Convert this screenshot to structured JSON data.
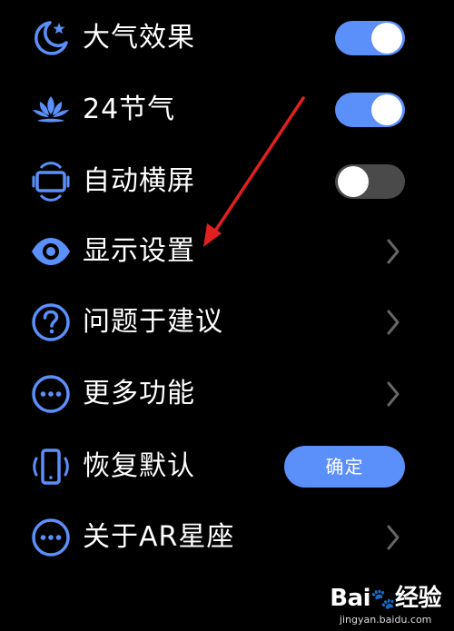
{
  "menu": {
    "items": [
      {
        "label": "大气效果",
        "icon": "moon-star-icon",
        "control": "toggle",
        "state": "on"
      },
      {
        "label": "24节气",
        "icon": "lotus-icon",
        "control": "toggle",
        "state": "on"
      },
      {
        "label": "自动横屏",
        "icon": "auto-rotate-icon",
        "control": "toggle",
        "state": "off"
      },
      {
        "label": "显示设置",
        "icon": "eye-icon",
        "control": "chevron"
      },
      {
        "label": "问题于建议",
        "icon": "question-icon",
        "control": "chevron"
      },
      {
        "label": "更多功能",
        "icon": "more-icon",
        "control": "chevron"
      },
      {
        "label": "恢复默认",
        "icon": "phone-reset-icon",
        "control": "button",
        "button_label": "确定"
      },
      {
        "label": "关于AR星座",
        "icon": "more-icon",
        "control": "chevron"
      }
    ]
  },
  "colors": {
    "accent": "#5b8ff9",
    "background": "#000000",
    "toggle_off": "#4a4a4a",
    "chevron": "#666666",
    "annotation_arrow": "#e02020"
  },
  "watermark": {
    "logo": "Bai du 经验",
    "url": "jingyan.baidu.com"
  }
}
